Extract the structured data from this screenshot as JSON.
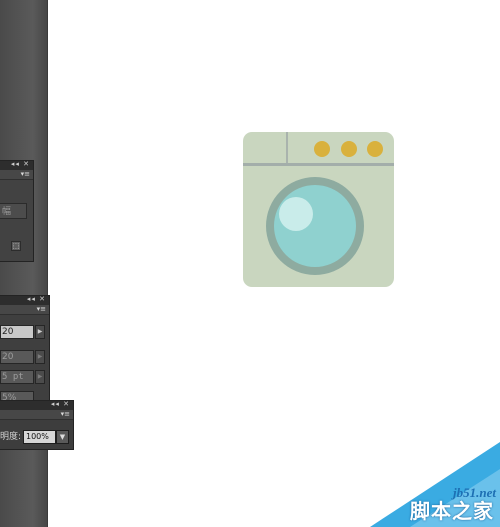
{
  "panels": {
    "top": {
      "field_text": "幅",
      "titlebar_icons": "◂◂ ✕",
      "menu_icon": "▾≡",
      "corner_glyph": "⬚"
    },
    "stroke": {
      "titlebar_icons": "◂◂ ✕",
      "menu_icon": "▾≡",
      "rows": [
        {
          "value": "20",
          "dim": false
        },
        {
          "value": "20",
          "dim": true
        },
        {
          "value": "5 pt",
          "dim": true
        },
        {
          "value": "5%",
          "dim": true
        }
      ],
      "step_glyph": "▶"
    },
    "transparency": {
      "titlebar_icons": "◂◂ ✕",
      "menu_icon": "▾≡",
      "opacity_label": "明度:",
      "opacity_value": "100%",
      "dropdown_glyph": "▼"
    }
  },
  "artwork": {
    "subject": "washing-machine",
    "colors": {
      "body": "#c9d6bf",
      "knob": "#d9b13d",
      "drum_ring": "#8eaba0",
      "drum_glass": "#8fd1cf"
    },
    "knob_count": 3
  },
  "watermark": {
    "url": "jb51.net",
    "text": "脚本之家"
  }
}
